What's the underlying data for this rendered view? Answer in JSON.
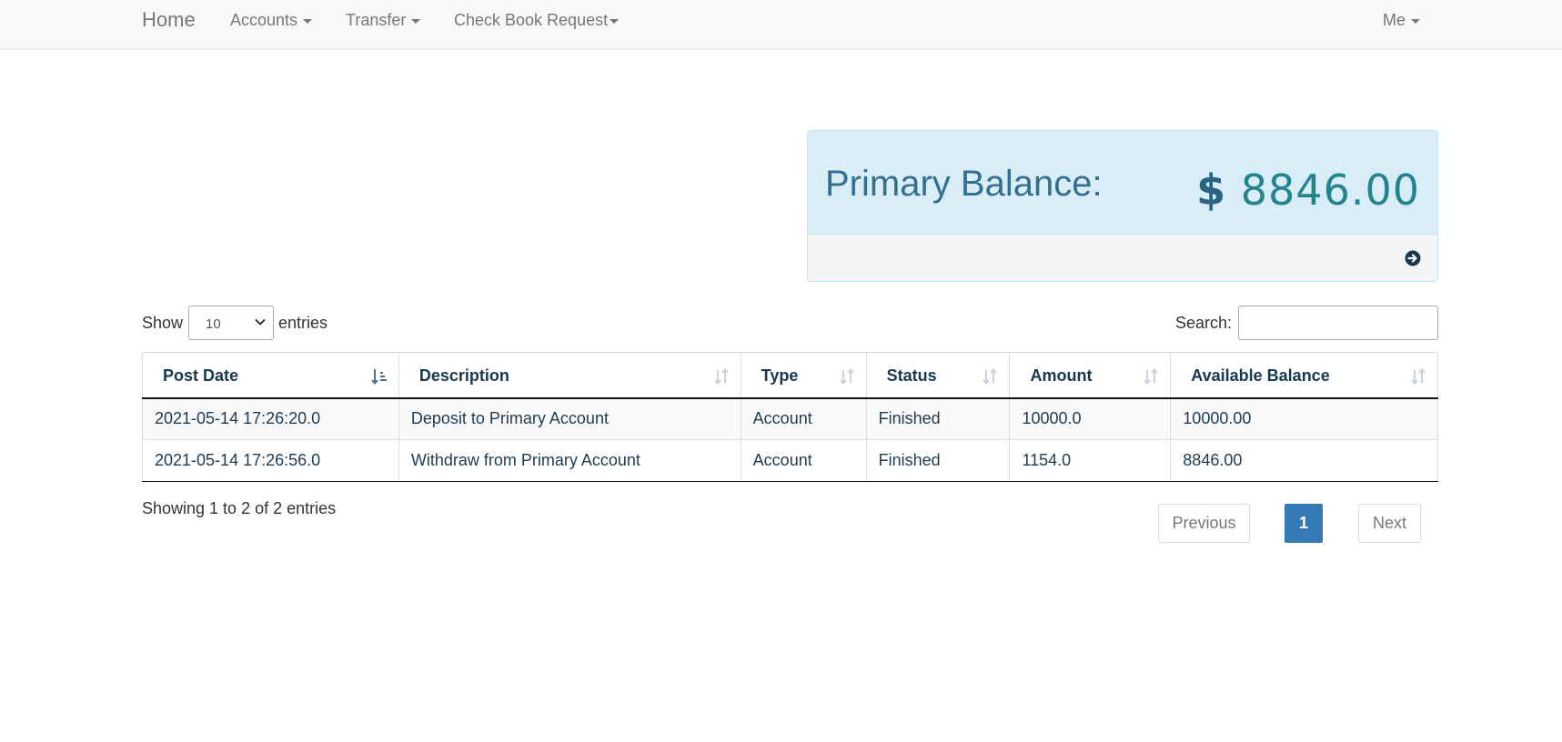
{
  "nav": {
    "brand": "Home",
    "accounts": "Accounts",
    "transfer": "Transfer",
    "checkbook": "Check Book Request",
    "me": "Me"
  },
  "balance": {
    "label": "Primary Balance:",
    "currency": "$",
    "amount": "8846.00"
  },
  "table_controls": {
    "show_label": "Show",
    "page_length": "10",
    "entries_label": "entries",
    "search_label": "Search:",
    "search_value": ""
  },
  "table": {
    "columns": [
      "Post Date",
      "Description",
      "Type",
      "Status",
      "Amount",
      "Available Balance"
    ],
    "rows": [
      [
        "2021-05-14 17:26:20.0",
        "Deposit to Primary Account",
        "Account",
        "Finished",
        "10000.0",
        "10000.00"
      ],
      [
        "2021-05-14 17:26:56.0",
        "Withdraw from Primary Account",
        "Account",
        "Finished",
        "1154.0",
        "8846.00"
      ]
    ]
  },
  "info": "Showing 1 to 2 of 2 entries",
  "pagination": {
    "previous": "Previous",
    "current": "1",
    "next": "Next"
  },
  "colors": {
    "panel_bg": "#d9edf7",
    "panel_text": "#31708f",
    "active_page": "#337ab7"
  }
}
